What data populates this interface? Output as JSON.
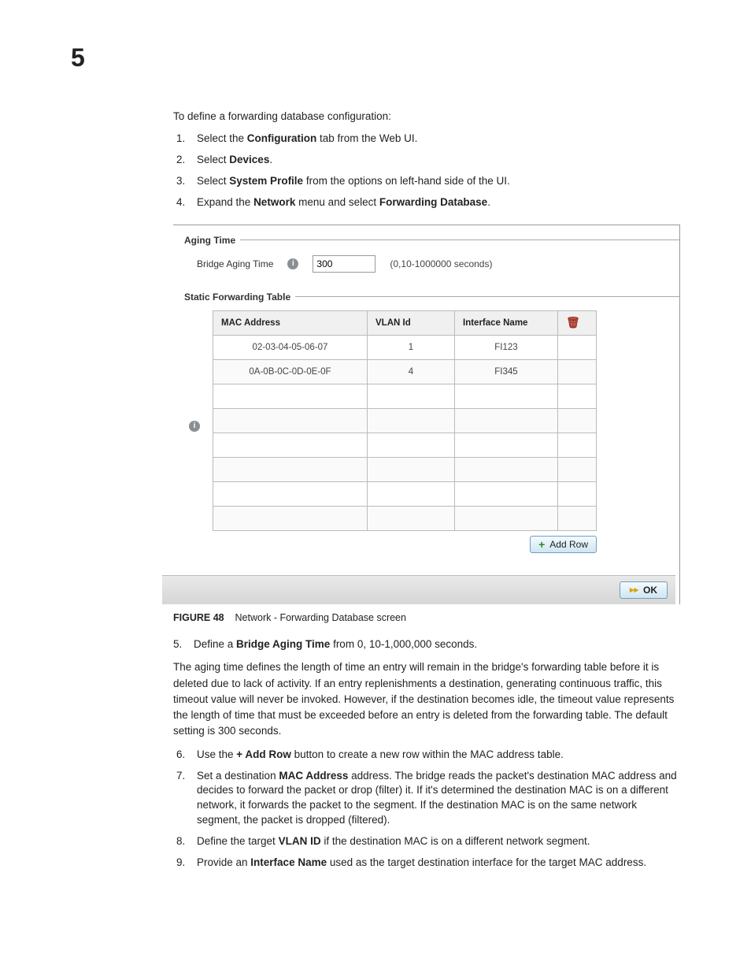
{
  "chapter": "5",
  "intro": "To define a forwarding database configuration:",
  "steps1": [
    {
      "n": "1.",
      "pre": "Select the ",
      "b": "Configuration",
      "post": " tab from the Web UI."
    },
    {
      "n": "2.",
      "pre": "Select ",
      "b": "Devices",
      "post": "."
    },
    {
      "n": "3.",
      "pre": "Select ",
      "b": "System Profile",
      "post": " from the options on left-hand side of the UI."
    },
    {
      "n": "4.",
      "pre": "Expand the ",
      "b": "Network",
      "post": " menu and select ",
      "b2": "Forwarding Database",
      "post2": "."
    }
  ],
  "panel": {
    "agingLegend": "Aging Time",
    "agingLabel": "Bridge Aging Time",
    "agingValue": "300",
    "agingHint": "(0,10-1000000 seconds)",
    "tableLegend": "Static Forwarding Table",
    "headers": {
      "mac": "MAC Address",
      "vlan": "VLAN Id",
      "if": "Interface Name"
    },
    "rows": [
      {
        "mac": "02-03-04-05-06-07",
        "vlan": "1",
        "if": "FI123"
      },
      {
        "mac": "0A-0B-0C-0D-0E-0F",
        "vlan": "4",
        "if": "FI345"
      },
      {
        "mac": "",
        "vlan": "",
        "if": ""
      },
      {
        "mac": "",
        "vlan": "",
        "if": ""
      },
      {
        "mac": "",
        "vlan": "",
        "if": ""
      },
      {
        "mac": "",
        "vlan": "",
        "if": ""
      },
      {
        "mac": "",
        "vlan": "",
        "if": ""
      },
      {
        "mac": "",
        "vlan": "",
        "if": ""
      }
    ],
    "addRow": "Add Row",
    "ok": "OK"
  },
  "caption": {
    "label": "FIGURE 48",
    "text": "Network - Forwarding Database screen"
  },
  "step5": {
    "n": "5.",
    "pre": "Define a ",
    "b": "Bridge Aging Time",
    "post": " from 0, 10-1,000,000 seconds."
  },
  "para": "The aging time defines the length of time an entry will remain in the bridge's forwarding table before it is deleted due to lack of activity. If an entry replenishments a destination, generating continuous traffic, this timeout value will never be invoked. However, if the destination becomes idle, the timeout value represents the length of time that must be exceeded before an entry is deleted from the forwarding table. The default setting is 300 seconds.",
  "steps2": [
    {
      "n": "6.",
      "pre": "Use the ",
      "b": "+ Add Row",
      "post": " button to create a new row within the MAC address table."
    },
    {
      "n": "7.",
      "pre": "Set a destination ",
      "b": "MAC Address",
      "post": " address. The bridge reads the packet's destination MAC address and decides to forward the packet or drop (filter) it. If it's determined the destination MAC is on a different network, it forwards the packet to the segment. If the destination MAC is on the same network segment, the packet is dropped (filtered)."
    },
    {
      "n": "8.",
      "pre": "Define the target ",
      "b": "VLAN ID",
      "post": " if the destination MAC is on a different network segment."
    },
    {
      "n": "9.",
      "pre": "Provide an ",
      "b": "Interface Name",
      "post": " used as the target destination interface for the target MAC address."
    }
  ]
}
